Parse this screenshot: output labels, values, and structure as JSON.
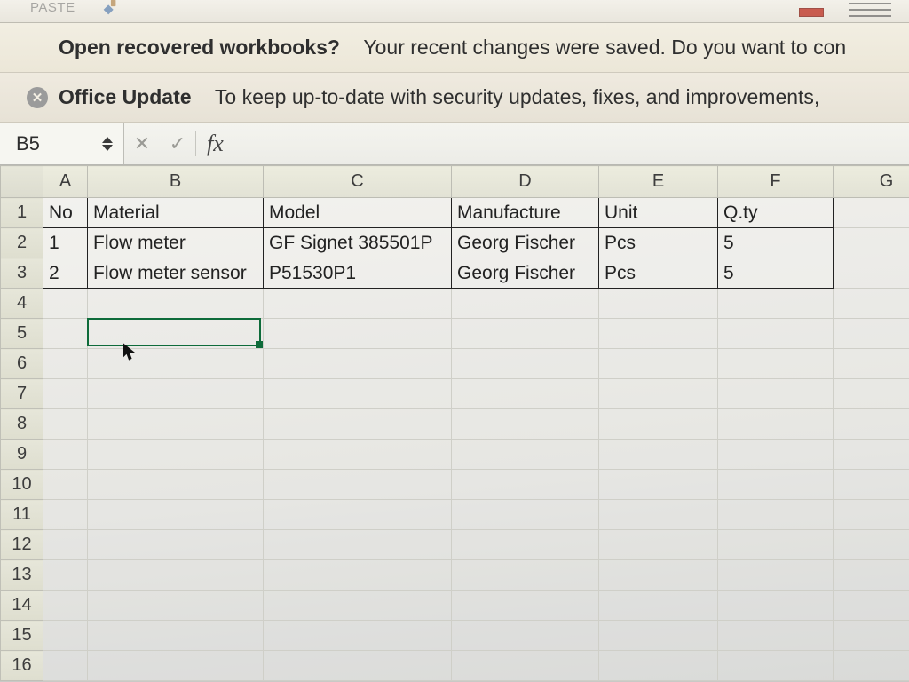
{
  "toolbar": {
    "paste_label": "Paste"
  },
  "messages": {
    "recover_title": "Open recovered workbooks?",
    "recover_body": "Your recent changes were saved. Do you want to con",
    "update_title": "Office Update",
    "update_body": "To keep up-to-date with security updates, fixes, and improvements,"
  },
  "formula_bar": {
    "name_box_value": "B5",
    "cancel_glyph": "✕",
    "accept_glyph": "✓",
    "fx_label": "fx",
    "formula_value": ""
  },
  "columns": [
    "A",
    "B",
    "C",
    "D",
    "E",
    "F",
    "G"
  ],
  "rows": [
    "1",
    "2",
    "3",
    "4",
    "5",
    "6",
    "7",
    "8",
    "9",
    "10",
    "11",
    "12",
    "13",
    "14",
    "15",
    "16"
  ],
  "table": {
    "headers": {
      "A": "No",
      "B": "Material",
      "C": "Model",
      "D": "Manufacture",
      "E": "Unit",
      "F": "Q.ty"
    },
    "rows": [
      {
        "A": "1",
        "B": "Flow meter",
        "C": "GF Signet 385501P",
        "D": "Georg Fischer",
        "E": "Pcs",
        "F": "5"
      },
      {
        "A": "2",
        "B": "Flow meter sensor",
        "C": "P51530P1",
        "D": "Georg Fischer",
        "E": "Pcs",
        "F": "5"
      }
    ]
  },
  "selection": {
    "cell": "B5"
  },
  "colors": {
    "selection_border": "#0e6b3a"
  }
}
